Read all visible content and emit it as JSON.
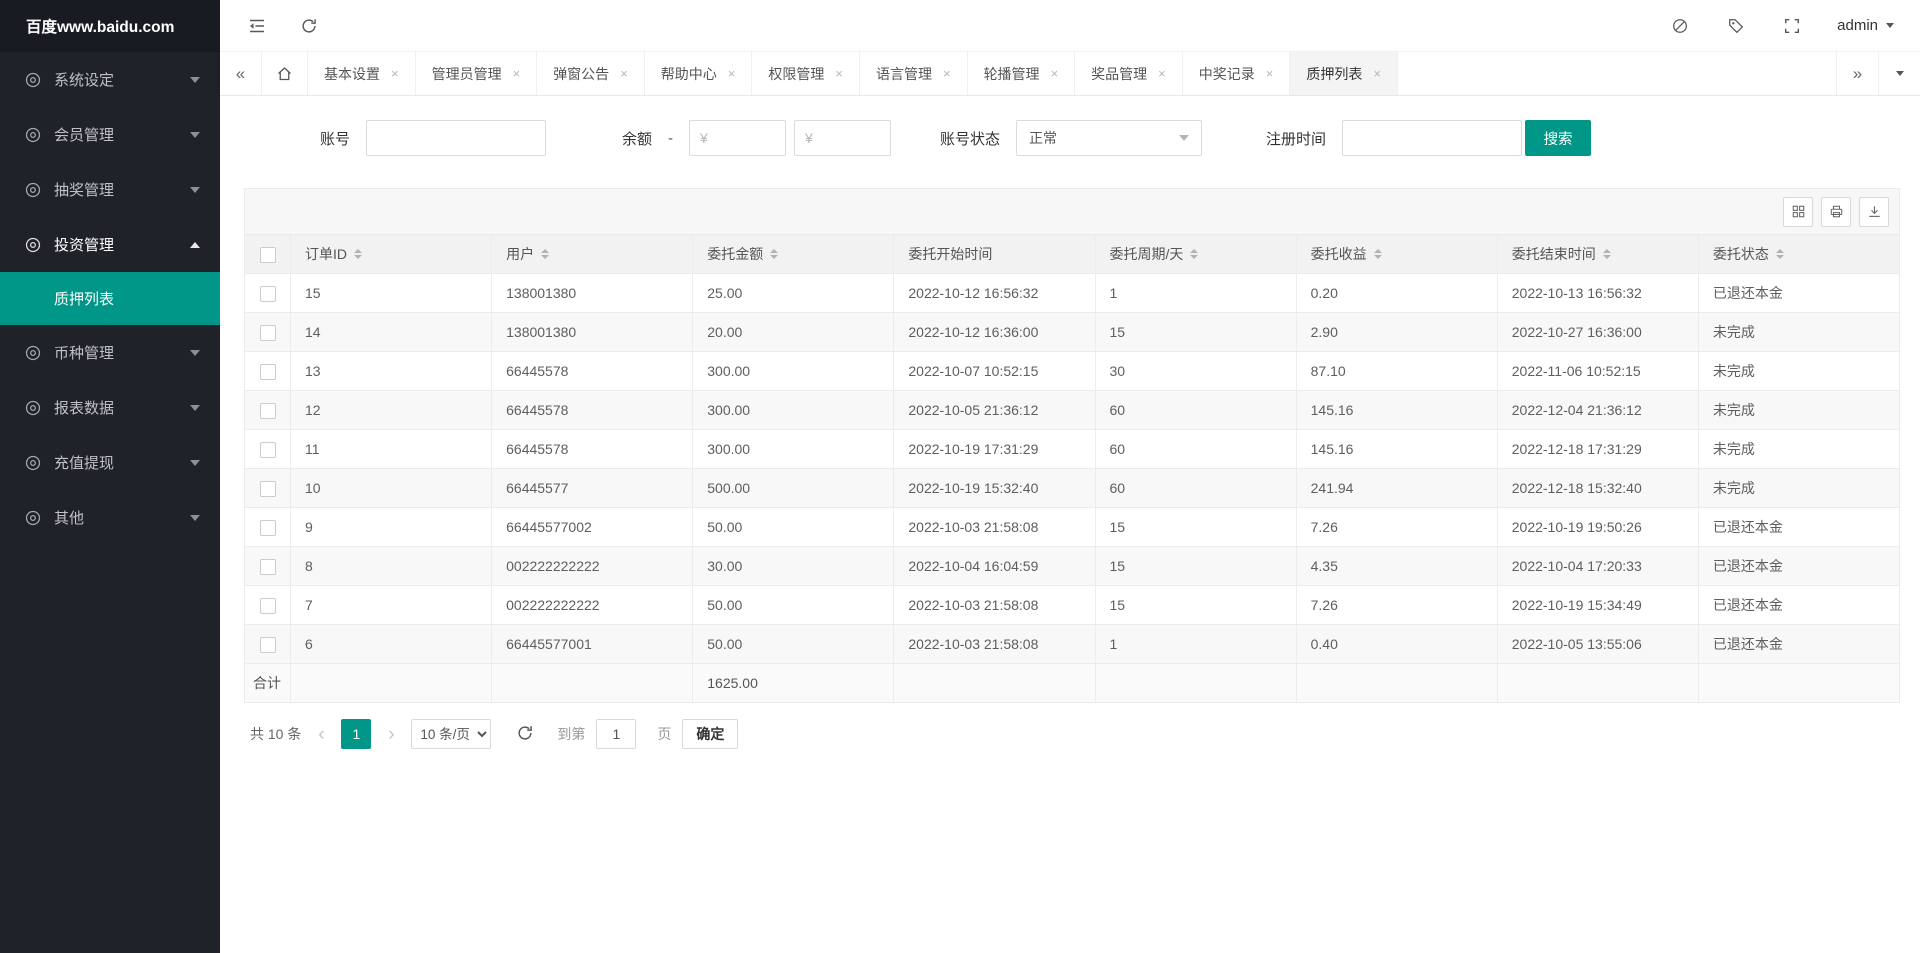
{
  "app": {
    "accent_color": "#009688",
    "sidebar_bg": "#20222a"
  },
  "sidebar": {
    "logo": "百度www.baidu.com",
    "items": [
      {
        "key": "system-settings",
        "icon": "gear-icon",
        "label": "系统设定",
        "expanded": false
      },
      {
        "key": "member-management",
        "icon": "user-icon",
        "label": "会员管理",
        "expanded": false
      },
      {
        "key": "lottery-management",
        "icon": "lottery-icon",
        "label": "抽奖管理",
        "expanded": false
      },
      {
        "key": "investment-management",
        "icon": "investment-icon",
        "label": "投资管理",
        "expanded": true,
        "children": [
          {
            "key": "pledge-list",
            "label": "质押列表",
            "active": true
          }
        ]
      },
      {
        "key": "currency-management",
        "icon": "coin-icon",
        "label": "币种管理",
        "expanded": false
      },
      {
        "key": "report-data",
        "icon": "report-icon",
        "label": "报表数据",
        "expanded": false
      },
      {
        "key": "recharge-withdraw",
        "icon": "wallet-icon",
        "label": "充值提现",
        "expanded": false
      },
      {
        "key": "other",
        "icon": "link-icon",
        "label": "其他",
        "expanded": false
      }
    ]
  },
  "topbar": {
    "username": "admin"
  },
  "tabbar": {
    "tabs": [
      {
        "label": "基本设置"
      },
      {
        "label": "管理员管理"
      },
      {
        "label": "弹窗公告"
      },
      {
        "label": "帮助中心"
      },
      {
        "label": "权限管理"
      },
      {
        "label": "语言管理"
      },
      {
        "label": "轮播管理"
      },
      {
        "label": "奖品管理"
      },
      {
        "label": "中奖记录"
      },
      {
        "label": "质押列表",
        "active": true
      }
    ]
  },
  "filters": {
    "account_label": "账号",
    "balance_label": "余额",
    "balance_separator": "-",
    "balance_min_placeholder": "¥",
    "balance_max_placeholder": "¥",
    "status_label": "账号状态",
    "status_value": "正常",
    "register_time_label": "注册时间",
    "search_button": "搜索"
  },
  "table": {
    "columns": [
      {
        "label": "订单ID",
        "sortable": true
      },
      {
        "label": "用户",
        "sortable": true
      },
      {
        "label": "委托金额",
        "sortable": true
      },
      {
        "label": "委托开始时间",
        "sortable": false
      },
      {
        "label": "委托周期/天",
        "sortable": true
      },
      {
        "label": "委托收益",
        "sortable": true
      },
      {
        "label": "委托结束时间",
        "sortable": true
      },
      {
        "label": "委托状态",
        "sortable": true
      }
    ],
    "rows": [
      {
        "order_id": "15",
        "user": "138001380",
        "amount": "25.00",
        "start_time": "2022-10-12 16:56:32",
        "period_days": "1",
        "profit": "0.20",
        "end_time": "2022-10-13 16:56:32",
        "status": "已退还本金"
      },
      {
        "order_id": "14",
        "user": "138001380",
        "amount": "20.00",
        "start_time": "2022-10-12 16:36:00",
        "period_days": "15",
        "profit": "2.90",
        "end_time": "2022-10-27 16:36:00",
        "status": "未完成"
      },
      {
        "order_id": "13",
        "user": "66445578",
        "amount": "300.00",
        "start_time": "2022-10-07 10:52:15",
        "period_days": "30",
        "profit": "87.10",
        "end_time": "2022-11-06 10:52:15",
        "status": "未完成"
      },
      {
        "order_id": "12",
        "user": "66445578",
        "amount": "300.00",
        "start_time": "2022-10-05 21:36:12",
        "period_days": "60",
        "profit": "145.16",
        "end_time": "2022-12-04 21:36:12",
        "status": "未完成"
      },
      {
        "order_id": "11",
        "user": "66445578",
        "amount": "300.00",
        "start_time": "2022-10-19 17:31:29",
        "period_days": "60",
        "profit": "145.16",
        "end_time": "2022-12-18 17:31:29",
        "status": "未完成"
      },
      {
        "order_id": "10",
        "user": "66445577",
        "amount": "500.00",
        "start_time": "2022-10-19 15:32:40",
        "period_days": "60",
        "profit": "241.94",
        "end_time": "2022-12-18 15:32:40",
        "status": "未完成"
      },
      {
        "order_id": "9",
        "user": "66445577002",
        "amount": "50.00",
        "start_time": "2022-10-03 21:58:08",
        "period_days": "15",
        "profit": "7.26",
        "end_time": "2022-10-19 19:50:26",
        "status": "已退还本金"
      },
      {
        "order_id": "8",
        "user": "002222222222",
        "amount": "30.00",
        "start_time": "2022-10-04 16:04:59",
        "period_days": "15",
        "profit": "4.35",
        "end_time": "2022-10-04 17:20:33",
        "status": "已退还本金"
      },
      {
        "order_id": "7",
        "user": "002222222222",
        "amount": "50.00",
        "start_time": "2022-10-03 21:58:08",
        "period_days": "15",
        "profit": "7.26",
        "end_time": "2022-10-19 15:34:49",
        "status": "已退还本金"
      },
      {
        "order_id": "6",
        "user": "66445577001",
        "amount": "50.00",
        "start_time": "2022-10-03 21:58:08",
        "period_days": "1",
        "profit": "0.40",
        "end_time": "2022-10-05 13:55:06",
        "status": "已退还本金"
      }
    ],
    "summary": {
      "label": "合计",
      "amount_total": "1625.00"
    }
  },
  "pagination": {
    "total_text": "共 10 条",
    "current_page": "1",
    "page_size_option": "10 条/页",
    "goto_label": "到第",
    "goto_value": "1",
    "page_unit_label": "页",
    "confirm_button": "确定"
  }
}
